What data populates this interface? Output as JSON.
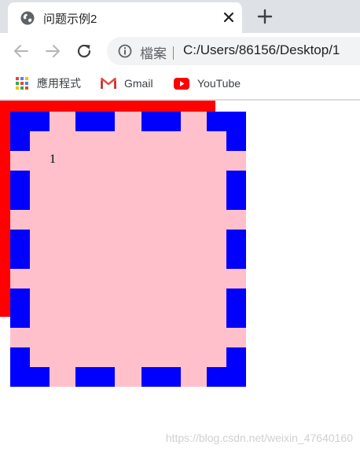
{
  "tab": {
    "title": "问题示例2"
  },
  "omnibox": {
    "scheme_label": "檔案｜",
    "url": "C:/Users/86156/Desktop/1"
  },
  "bookmarks": {
    "apps": "應用程式",
    "gmail": "Gmail",
    "youtube": "YouTube"
  },
  "page": {
    "text": "1",
    "colors": {
      "outer_box": "#ff0000",
      "inner_box": "#ffc0cb",
      "dashed_border": "#0000ff"
    }
  },
  "watermark": "https://blog.csdn.net/weixin_47640160"
}
